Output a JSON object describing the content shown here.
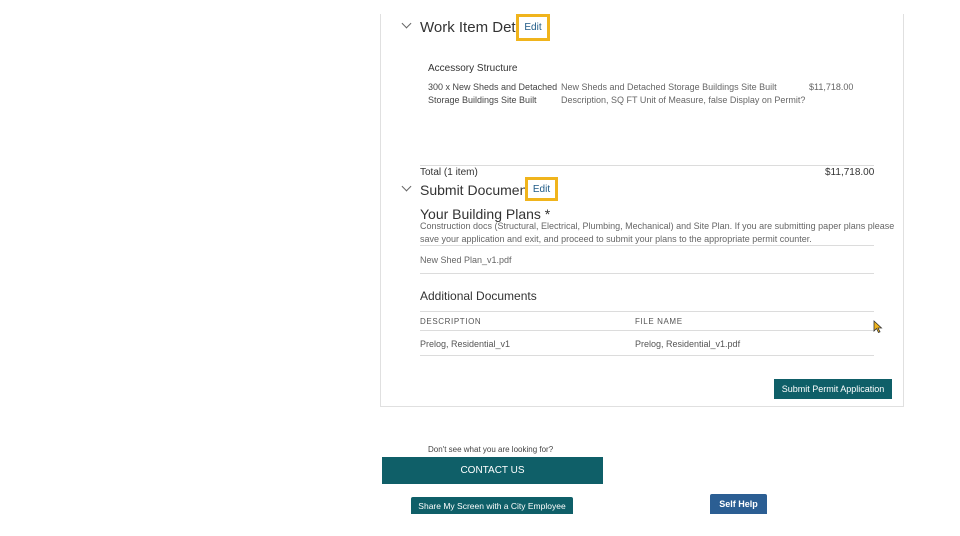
{
  "work_item": {
    "title": "Work Item Details",
    "edit_label": "Edit",
    "category": "Accessory Structure",
    "item_name_line1": "300 x New Sheds and Detached",
    "item_name_line2": "Storage Buildings Site Built",
    "item_desc_line1": "New Sheds and Detached Storage Buildings Site Built",
    "item_desc_line2": "Description, SQ FT Unit of Measure, false Display on Permit?",
    "item_price": "$11,718.00",
    "total_label": "Total (1 item)",
    "total_value": "$11,718.00"
  },
  "submit_docs": {
    "title": "Submit Documents",
    "edit_label": "Edit",
    "plans_title": "Your Building Plans *",
    "plans_desc_line1": "Construction docs (Structural, Electrical, Plumbing, Mechanical) and Site Plan. If you are submitting paper plans please",
    "plans_desc_line2": "save your application and exit, and proceed to submit your plans to the appropriate permit counter.",
    "plans_file": "New Shed Plan_v1.pdf",
    "additional_title": "Additional Documents",
    "col_description": "DESCRIPTION",
    "col_file_name": "FILE NAME",
    "rows": [
      {
        "description": "Prelog, Residential_v1",
        "file_name": "Prelog, Residential_v1.pdf"
      }
    ]
  },
  "submit_button": "Submit Permit Application",
  "footer": {
    "help_text": "Don't see what you are looking for?",
    "contact_button": "CONTACT US",
    "share_button": "Share My Screen with a City Employee",
    "self_help_button": "Self Help"
  },
  "colors": {
    "teal": "#0f5f68",
    "self_help_blue": "#2b5e93",
    "highlight": "#f0b41c",
    "link": "#1e5a86"
  }
}
